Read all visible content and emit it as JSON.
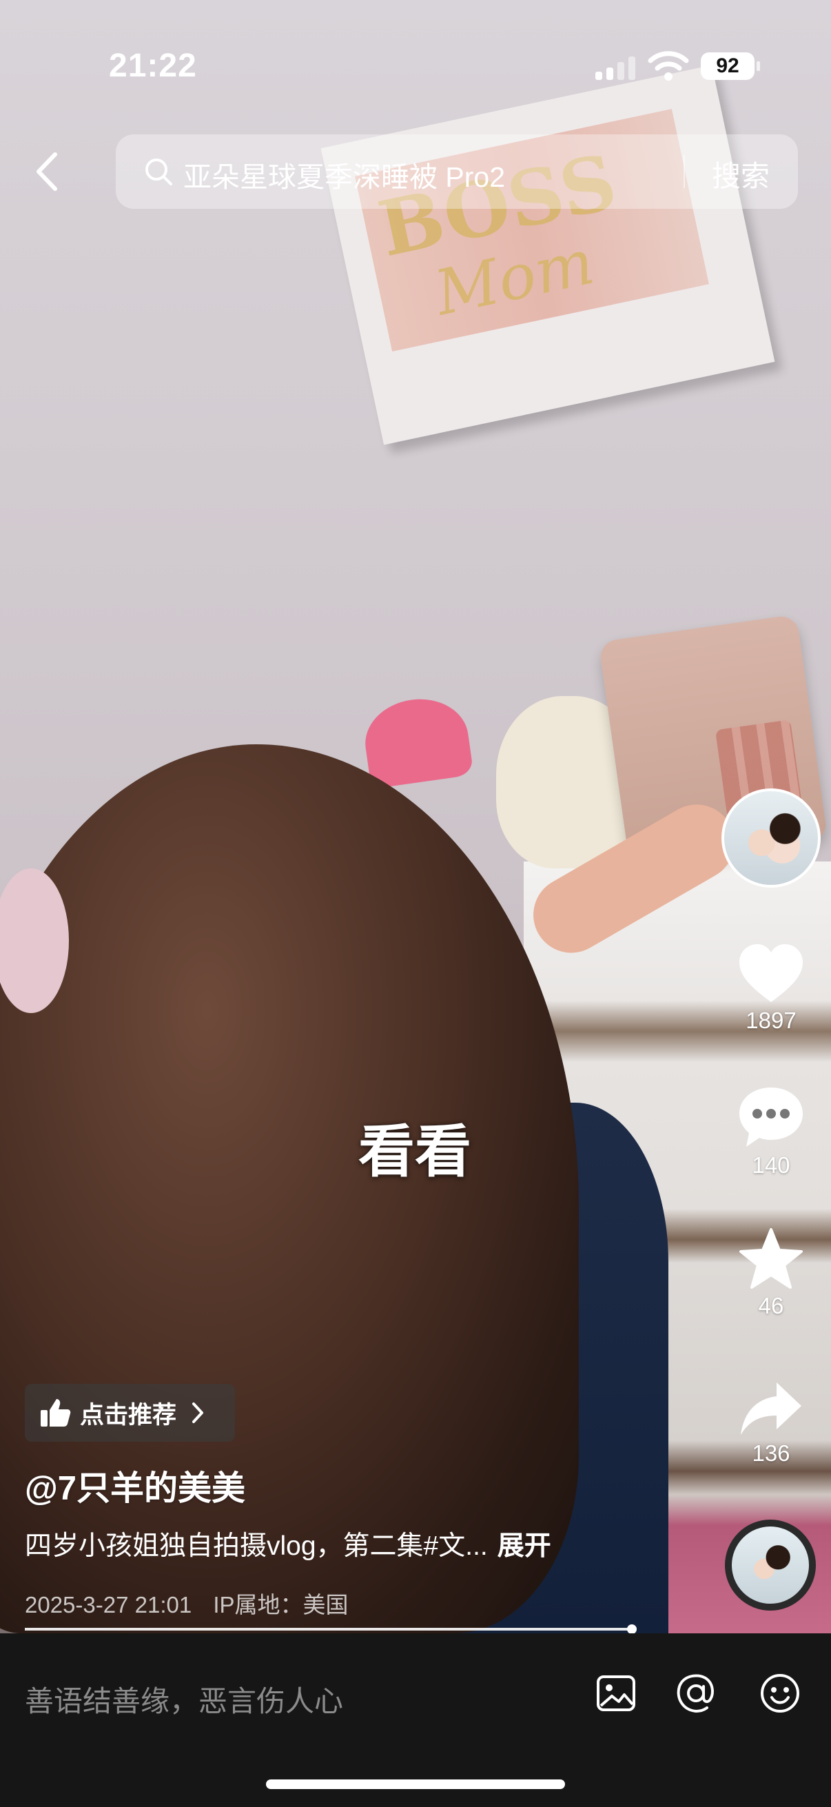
{
  "status_bar": {
    "time": "21:22",
    "battery": "92"
  },
  "header": {
    "search_text": "亚朵星球夏季深睡被 Pro2",
    "search_button": "搜索"
  },
  "video": {
    "caption": "看看"
  },
  "actions": {
    "like_count": "1897",
    "comment_count": "140",
    "favorite_count": "46",
    "share_count": "136"
  },
  "post": {
    "recommend_label": "点击推荐",
    "author": "@7只羊的美美",
    "description": "四岁小孩姐独自拍摄vlog，第二集#文...",
    "expand_label": "展开",
    "date": "2025-3-27 21:01",
    "ip_location": "IP属地：美国"
  },
  "comment_bar": {
    "placeholder": "善语结善缘，恶言伤人心"
  },
  "colors": {
    "comment_bar_bg": "#161616",
    "text_primary": "#ffffff",
    "placeholder": "#8b8b8b"
  }
}
